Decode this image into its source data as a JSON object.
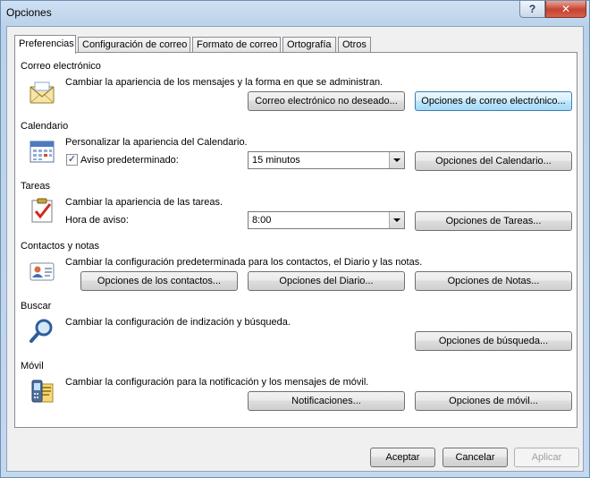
{
  "window": {
    "title": "Opciones",
    "help_label": "?",
    "close_label": "✕"
  },
  "tabs": [
    {
      "label": "Preferencias"
    },
    {
      "label": "Configuración de correo"
    },
    {
      "label": "Formato de correo"
    },
    {
      "label": "Ortografía"
    },
    {
      "label": "Otros"
    }
  ],
  "sections": {
    "mail": {
      "title": "Correo electrónico",
      "desc": "Cambiar la apariencia de los mensajes y la forma en que se administran.",
      "junk_button": "Correo electrónico no deseado...",
      "options_button": "Opciones de correo electrónico..."
    },
    "calendar": {
      "title": "Calendario",
      "desc": "Personalizar la apariencia del Calendario.",
      "reminder_label": "Aviso predeterminado:",
      "reminder_checked": true,
      "check_mark": "✓",
      "reminder_value": "15 minutos",
      "options_button": "Opciones del Calendario..."
    },
    "tasks": {
      "title": "Tareas",
      "desc": "Cambiar la apariencia de las tareas.",
      "reminder_label": "Hora de aviso:",
      "reminder_value": "8:00",
      "options_button": "Opciones de Tareas..."
    },
    "contacts": {
      "title": "Contactos y notas",
      "desc": "Cambiar la configuración predeterminada para los contactos, el Diario y las notas.",
      "contacts_button": "Opciones de los contactos...",
      "journal_button": "Opciones del Diario...",
      "notes_button": "Opciones de Notas..."
    },
    "search": {
      "title": "Buscar",
      "desc": "Cambiar la configuración de indización y búsqueda.",
      "options_button": "Opciones de búsqueda..."
    },
    "mobile": {
      "title": "Móvil",
      "desc": "Cambiar la configuración para la notificación y los mensajes de móvil.",
      "notifications_button": "Notificaciones...",
      "options_button": "Opciones de móvil..."
    }
  },
  "footer": {
    "accept": "Aceptar",
    "cancel": "Cancelar",
    "apply": "Aplicar"
  },
  "icons": {
    "mail": "envelope-icon",
    "calendar": "calendar-icon",
    "tasks": "task-checklist-icon",
    "contacts": "contact-card-icon",
    "search": "magnifier-icon",
    "mobile": "mobile-phone-icon"
  }
}
